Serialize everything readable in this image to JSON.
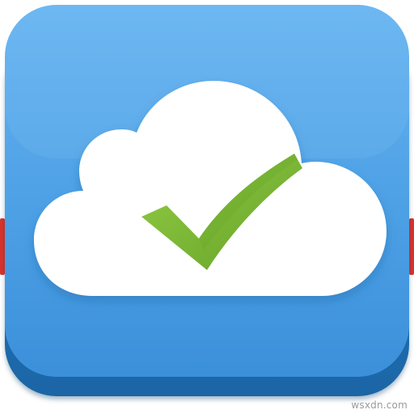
{
  "app_icon": {
    "icons": [
      "cloud-icon",
      "checkmark-icon"
    ],
    "colors": {
      "tile_top": "#5aaef0",
      "tile_bottom": "#3d92dc",
      "tile_edge": "#2f86cf",
      "tile_depth": "#1f6fb3",
      "cloud_fill": "#ffffff",
      "check_light": "#8cc63f",
      "check_dark": "#6aa52a",
      "red_edge": "#d9332b"
    }
  },
  "watermark": {
    "text": "wsxdn.com"
  }
}
